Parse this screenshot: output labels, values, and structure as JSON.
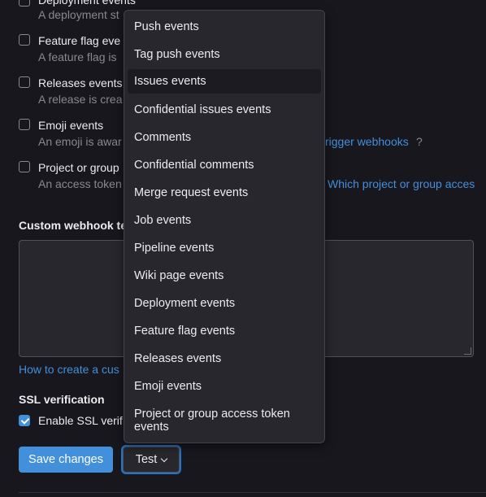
{
  "events": [
    {
      "label": "Deployment events",
      "help": "A deployment st"
    },
    {
      "label": "Feature flag eve",
      "help": "A feature flag is"
    },
    {
      "label": "Releases events",
      "help": "A release is crea"
    },
    {
      "label": "Emoji events",
      "help": "An emoji is awar",
      "help_link": "rigger webhooks",
      "help_suffix": "?"
    },
    {
      "label": "Project or group",
      "help": "An access token",
      "help_link": "Which project or group acces"
    }
  ],
  "custom_template": {
    "title": "Custom webhook te",
    "help_link": "How to create a cus"
  },
  "ssl": {
    "title": "SSL verification",
    "checkbox_label": "Enable SSL verif",
    "checked": true
  },
  "actions": {
    "save_label": "Save changes",
    "test_label": "Test"
  },
  "dropdown": {
    "active_index": 2,
    "items": [
      "Push events",
      "Tag push events",
      "Issues events",
      "Confidential issues events",
      "Comments",
      "Confidential comments",
      "Merge request events",
      "Job events",
      "Pipeline events",
      "Wiki page events",
      "Deployment events",
      "Feature flag events",
      "Releases events",
      "Emoji events",
      "Project or group access token events"
    ]
  },
  "colors": {
    "background": "#18171d",
    "accent": "#428fdc",
    "dropdown_bg": "#28272d"
  }
}
